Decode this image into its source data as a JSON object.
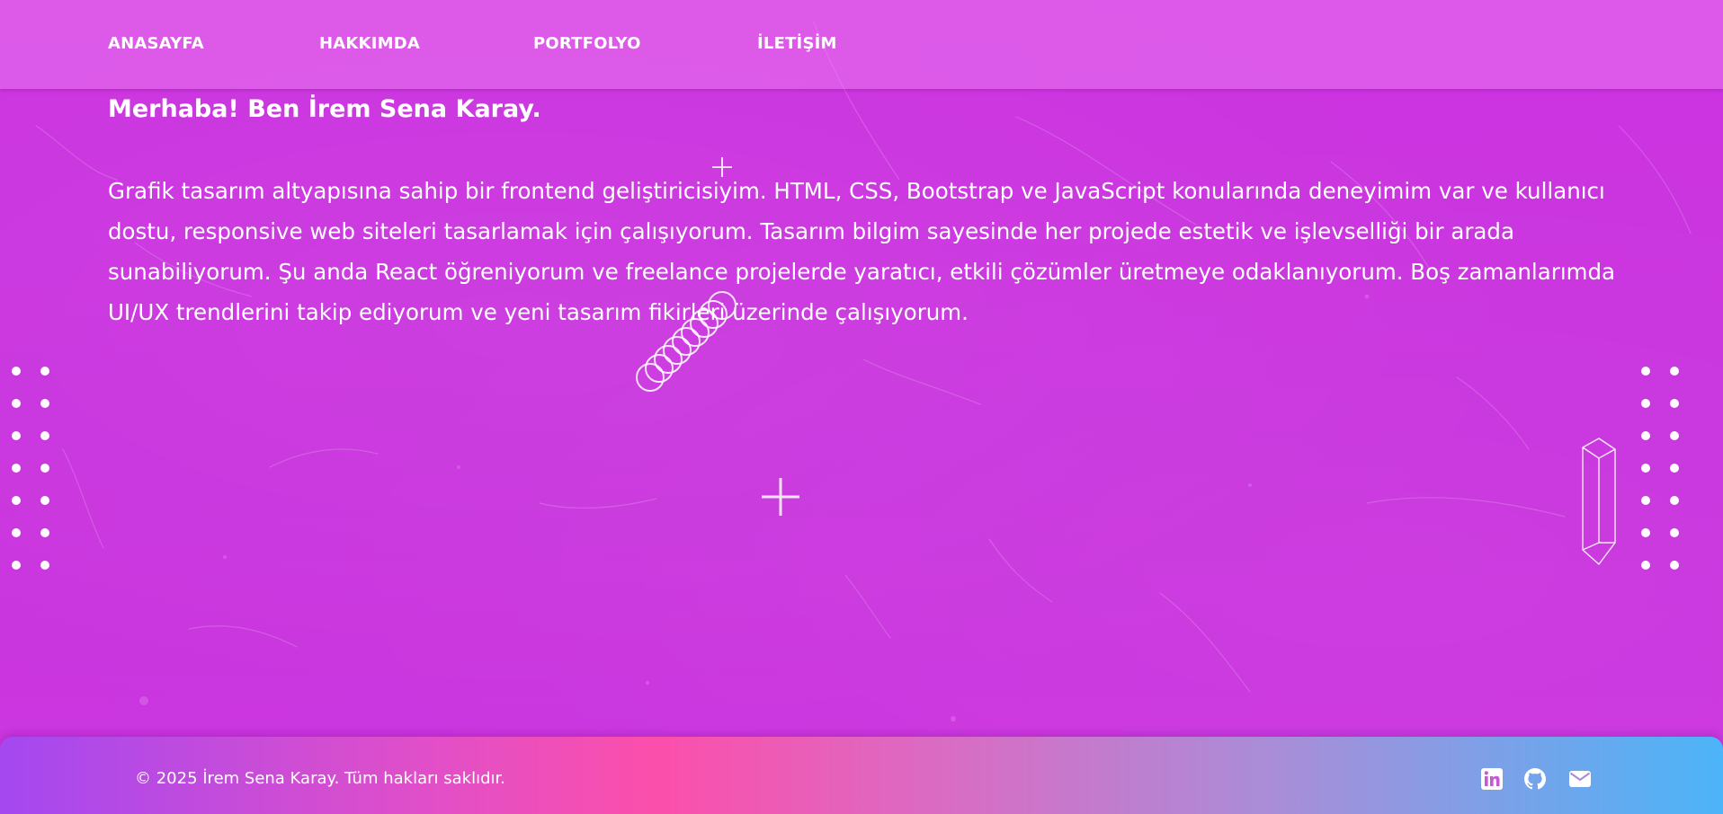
{
  "nav": {
    "items": [
      {
        "label": "ANASAYFA"
      },
      {
        "label": "HAKKIMDA"
      },
      {
        "label": "PORTFOLYO"
      },
      {
        "label": "İLETİŞİM"
      }
    ]
  },
  "about": {
    "title": "Merhaba! Ben İrem Sena Karay.",
    "text": "Grafik tasarım altyapısına sahip bir frontend geliştiricisiyim. HTML, CSS, Bootstrap ve JavaScript konularında deneyimim var ve kullanıcı dostu, responsive web siteleri tasarlamak için çalışıyorum. Tasarım bilgim sayesinde her projede estetik ve işlevselliği bir arada sunabiliyorum. Şu anda React öğreniyorum ve freelance projelerde yaratıcı, etkili çözümler üretmeye odaklanıyorum. Boş zamanlarımda UI/UX trendlerini takip ediyorum ve yeni tasarım fikirleri üzerinde çalışıyorum."
  },
  "footer": {
    "copyright": "© 2025 İrem Sena Karay. Tüm hakları saklıdır.",
    "social": [
      {
        "icon": "linkedin-icon"
      },
      {
        "icon": "github-icon"
      },
      {
        "icon": "mail-icon"
      }
    ]
  },
  "colors": {
    "background": "#c935de",
    "navbar": "#e57ef0",
    "footer_gradient": [
      "#a448f0",
      "#fb4fab",
      "#4cb4f8"
    ],
    "text": "#ffffff"
  }
}
